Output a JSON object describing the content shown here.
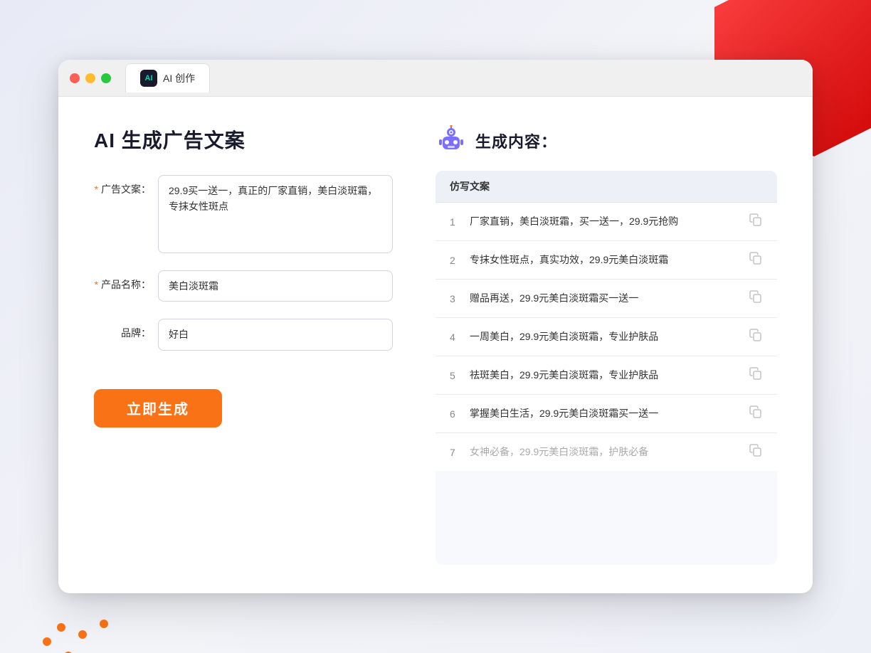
{
  "window": {
    "tab_icon_text": "AI",
    "tab_title": "AI 创作"
  },
  "left_panel": {
    "page_title": "AI 生成广告文案",
    "form": {
      "ad_copy_label": "广告文案：",
      "ad_copy_required": true,
      "ad_copy_value": "29.9买一送一，真正的厂家直销，美白淡斑霜，专抹女性斑点",
      "product_name_label": "产品名称：",
      "product_name_required": true,
      "product_name_value": "美白淡斑霜",
      "brand_label": "品牌：",
      "brand_required": false,
      "brand_value": "好白"
    },
    "submit_button": "立即生成"
  },
  "right_panel": {
    "result_title": "生成内容：",
    "table_header": "仿写文案",
    "rows": [
      {
        "num": "1",
        "text": "厂家直销，美白淡斑霜，买一送一，29.9元抢购",
        "muted": false
      },
      {
        "num": "2",
        "text": "专抹女性斑点，真实功效，29.9元美白淡斑霜",
        "muted": false
      },
      {
        "num": "3",
        "text": "赠品再送，29.9元美白淡斑霜买一送一",
        "muted": false
      },
      {
        "num": "4",
        "text": "一周美白，29.9元美白淡斑霜，专业护肤品",
        "muted": false
      },
      {
        "num": "5",
        "text": "祛斑美白，29.9元美白淡斑霜，专业护肤品",
        "muted": false
      },
      {
        "num": "6",
        "text": "掌握美白生活，29.9元美白淡斑霜买一送一",
        "muted": false
      },
      {
        "num": "7",
        "text": "女神必备，29.9元美白淡斑霜，护肤必备",
        "muted": true
      }
    ]
  }
}
